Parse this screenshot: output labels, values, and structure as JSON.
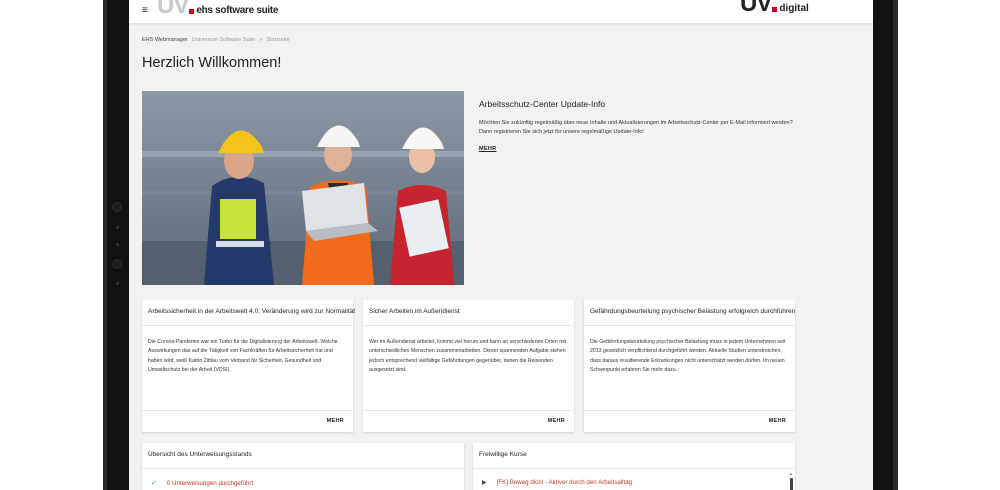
{
  "header": {
    "logo_left_mark": "UV",
    "logo_left_text": "ehs software suite",
    "logo_right_mark": "UV",
    "logo_right_text": "digital",
    "menu_glyph": "≡"
  },
  "breadcrumb": [
    "EHS Webmanager",
    "Universum Software Suite",
    "»",
    "Startseite"
  ],
  "page_title": "Herzlich Willkommen!",
  "hero": {
    "title": "Arbeitsschutz-Center Update-Info",
    "body": "Möchten Sie zukünftig regelmäßig über neue Inhalte und Aktualisierungen im Arbeitsschutz-Center per E-Mail informiert werden? Dann registrieren Sie sich jetzt für unsere regelmäßige Update-Info!",
    "more": "MEHR"
  },
  "cards": [
    {
      "title": "Arbeitssicherheit in der Arbeitswelt 4.0: Veränderung wird zur Normalität",
      "body": "Die Corona-Pandemie war ein Turbo für die Digitalisierung der Arbeitswelt. Welche Auswirkungen das auf die Tätigkeit von Fachkräften für Arbeitssicherheit hat und haben wird, weiß Katrin Zittlau vom Verband für Sicherheit, Gesundheit und Umweltschutz bei der Arbeit (VDSI).",
      "more": "MEHR"
    },
    {
      "title": "Sicher Arbeiten im Außendienst",
      "body": "Wer im Außendienst arbeitet, kommt viel herum und kann an verschiedenen Orten mit unterschiedlichen Menschen zusammenarbeiten. Dieser spannenden Aufgabe stehen jedoch entsprechend vielfältige Gefährdungen gegenüber, denen die Reisenden ausgesetzt sind.",
      "more": "MEHR"
    },
    {
      "title": "Gefährdungsbeurteilung psychischer Belastung erfolgreich durchführen",
      "body": "Die Gefährdungsbeurteilung psychischer Belastung muss in jedem Unternehmen seit 2013 gesetzlich verpflichtend durchgeführt werden. Aktuelle Studien unterstreichen, dass daraus resultierende Erkrankungen nicht unterschätzt werden dürfen. Im neuen Schwerpunkt erfahren Sie mehr dazu.",
      "more": "MEHR"
    }
  ],
  "panels": {
    "instruction": {
      "title": "Übersicht des Unterweisungsstands",
      "row": "0 Unterweisungen durchgeführt"
    },
    "courses": {
      "title": "Freiwillige Kurse",
      "row": "[FK] Beweg dich! - Aktiver durch den Arbeitsalltag"
    }
  },
  "colors": {
    "accent_red": "#d0021b",
    "link_red": "#c0392b",
    "check_green": "#3a9d3a"
  }
}
